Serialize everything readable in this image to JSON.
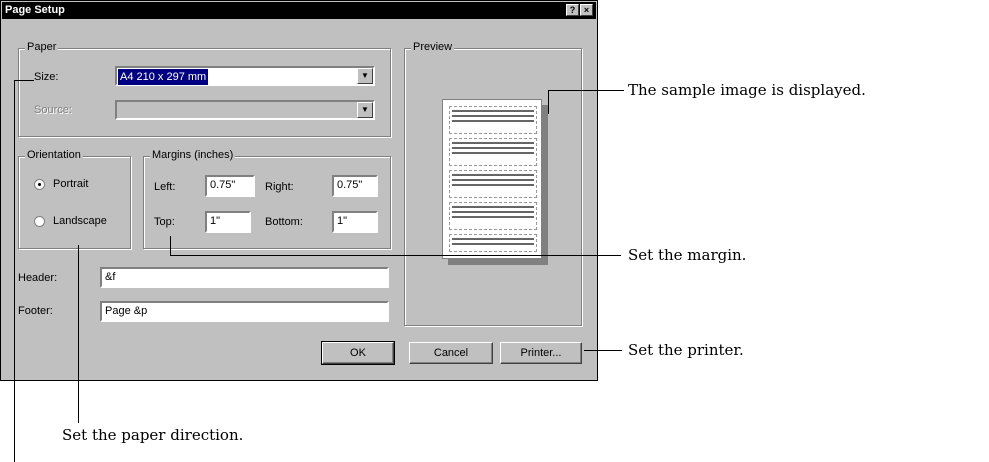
{
  "dialog": {
    "title": "Page Setup",
    "help_button": "?",
    "close_button": "×"
  },
  "paper": {
    "legend": "Paper",
    "size_label": "Size:",
    "size_value": "A4 210 x 297 mm",
    "source_label": "Source:",
    "source_value": ""
  },
  "orientation": {
    "legend": "Orientation",
    "portrait_label": "Portrait",
    "landscape_label": "Landscape",
    "selected": "Portrait"
  },
  "margins": {
    "legend": "Margins (inches)",
    "left_label": "Left:",
    "left_value": "0.75\"",
    "right_label": "Right:",
    "right_value": "0.75\"",
    "top_label": "Top:",
    "top_value": "1\"",
    "bottom_label": "Bottom:",
    "bottom_value": "1\""
  },
  "header": {
    "label": "Header:",
    "value": "&f"
  },
  "footer": {
    "label": "Footer:",
    "value": "Page &p"
  },
  "preview": {
    "legend": "Preview"
  },
  "buttons": {
    "ok": "OK",
    "cancel": "Cancel",
    "printer": "Printer..."
  },
  "annotations": {
    "sample": "The sample image is displayed.",
    "margin": "Set the margin.",
    "printer": "Set the printer.",
    "direction": "Set the paper direction."
  },
  "colors": {
    "title_bar": "#000000",
    "dialog_bg": "#c0c0c0",
    "selection": "#000080"
  }
}
